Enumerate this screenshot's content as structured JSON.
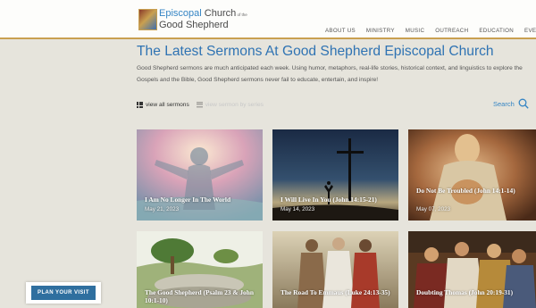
{
  "header": {
    "logo": {
      "line1_accent": "Episcopal",
      "line1_rest": " Church",
      "line1_small": " of the",
      "line2": "Good Shepherd"
    },
    "nav": [
      "ABOUT US",
      "MINISTRY",
      "MUSIC",
      "OUTREACH",
      "EDUCATION",
      "EVENTS"
    ]
  },
  "main": {
    "title": "The Latest Sermons At Good Shepherd Episcopal Church",
    "intro": "Good Shepherd sermons are much anticipated each week. Using humor, metaphors, real-life stories, historical context, and linguistics to explore the Gospels and the Bible, Good Shepherd sermons never fail to educate, entertain, and inspire!",
    "view_all": "view all sermons",
    "view_series": "view sermon by series",
    "search_label": "Search",
    "cards": [
      {
        "title": "I Am No Longer In The World",
        "date": "May 21, 2023"
      },
      {
        "title": "I Will Live In You (John 14:15-21)",
        "date": "May 14, 2023"
      },
      {
        "title": "Do Not Be Troubled (John 14:1-14)",
        "date": "May 07, 2023"
      },
      {
        "title": "The Good Shepherd (Psalm 23 & John 10:1-10)",
        "date": ""
      },
      {
        "title": "The Road To Emmaus (Luke 24:13-35)",
        "date": ""
      },
      {
        "title": "Doubting Thomas (John 20:19-31)",
        "date": ""
      }
    ]
  },
  "cta": {
    "plan_visit": "PLAN YOUR VISIT"
  },
  "colors": {
    "accent_blue": "#2f73b3",
    "gold": "#c9a050",
    "button": "#2f6f9f"
  }
}
